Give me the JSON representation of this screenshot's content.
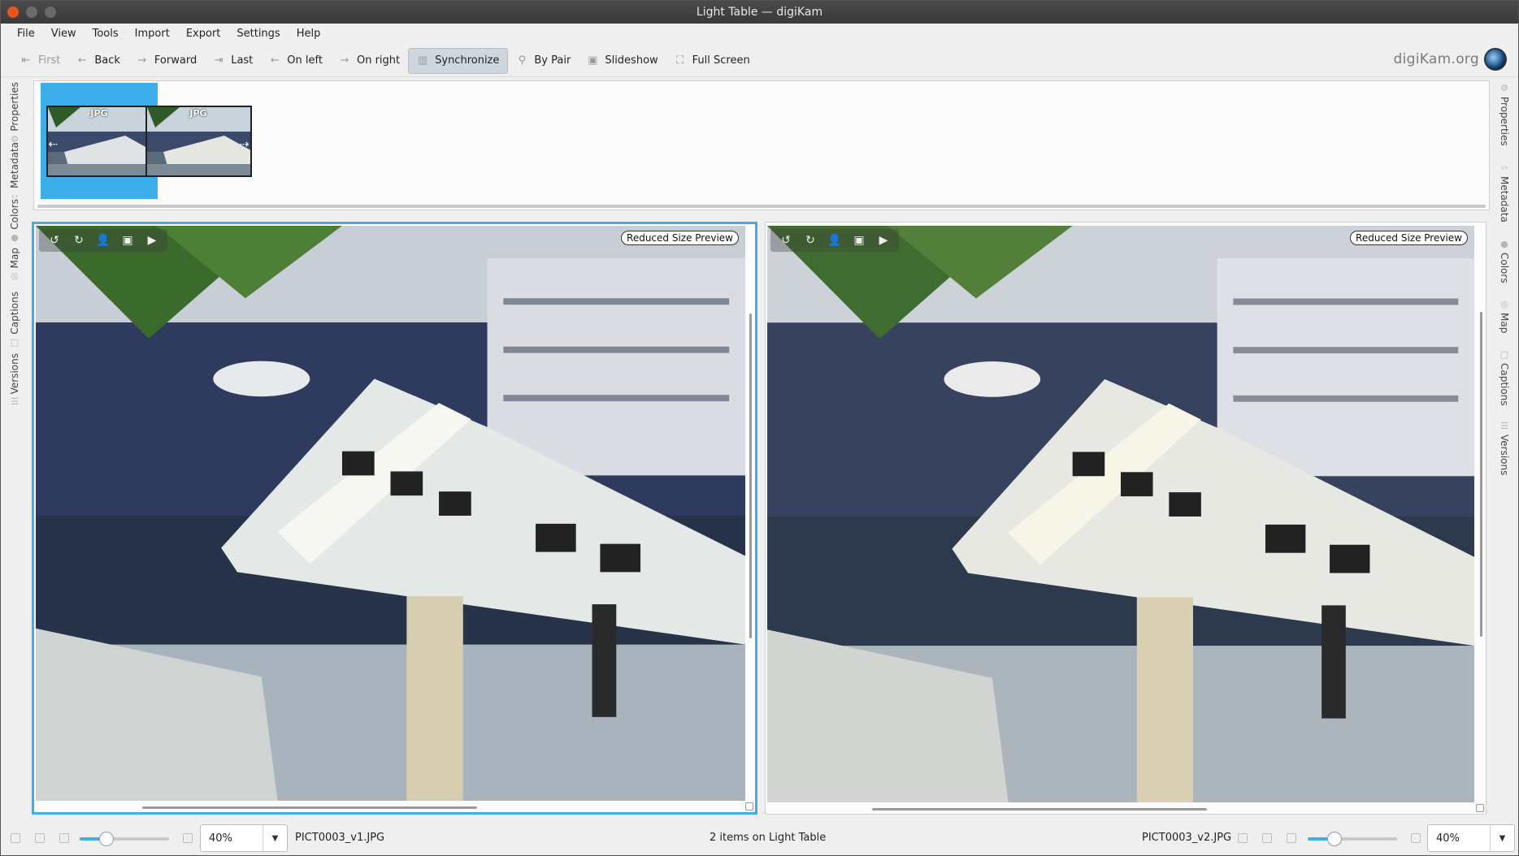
{
  "window": {
    "title": "Light Table — digiKam"
  },
  "menu": [
    "File",
    "View",
    "Tools",
    "Import",
    "Export",
    "Settings",
    "Help"
  ],
  "toolbar": {
    "first": "First",
    "back": "Back",
    "forward": "Forward",
    "last": "Last",
    "on_left": "On left",
    "on_right": "On right",
    "synchronize": "Synchronize",
    "by_pair": "By Pair",
    "slideshow": "Slideshow",
    "full_screen": "Full Screen",
    "brand": "digiKam.org"
  },
  "left_sidebar": [
    "Properties",
    "Metadata",
    "Colors",
    "Map",
    "Captions",
    "Versions"
  ],
  "right_sidebar": [
    "Properties",
    "Metadata",
    "Colors",
    "Map",
    "Captions",
    "Versions"
  ],
  "thumbs": [
    {
      "badge": "JPG",
      "selected": true
    },
    {
      "badge": "JPG",
      "selected": false
    }
  ],
  "panes": {
    "left": {
      "badge": "Reduced Size Preview"
    },
    "right": {
      "badge": "Reduced Size Preview"
    }
  },
  "status": {
    "left_zoom": "40%",
    "left_file": "PICT0003_v1.JPG",
    "center": "2 items on Light Table",
    "right_file": "PICT0003_v2.JPG",
    "right_zoom": "40%",
    "left_slider_level": 0.3,
    "right_slider_level": 0.3
  },
  "colors": {
    "accent": "#3daee9",
    "title_bar": "#3a3a3a",
    "close": "#e95420"
  }
}
